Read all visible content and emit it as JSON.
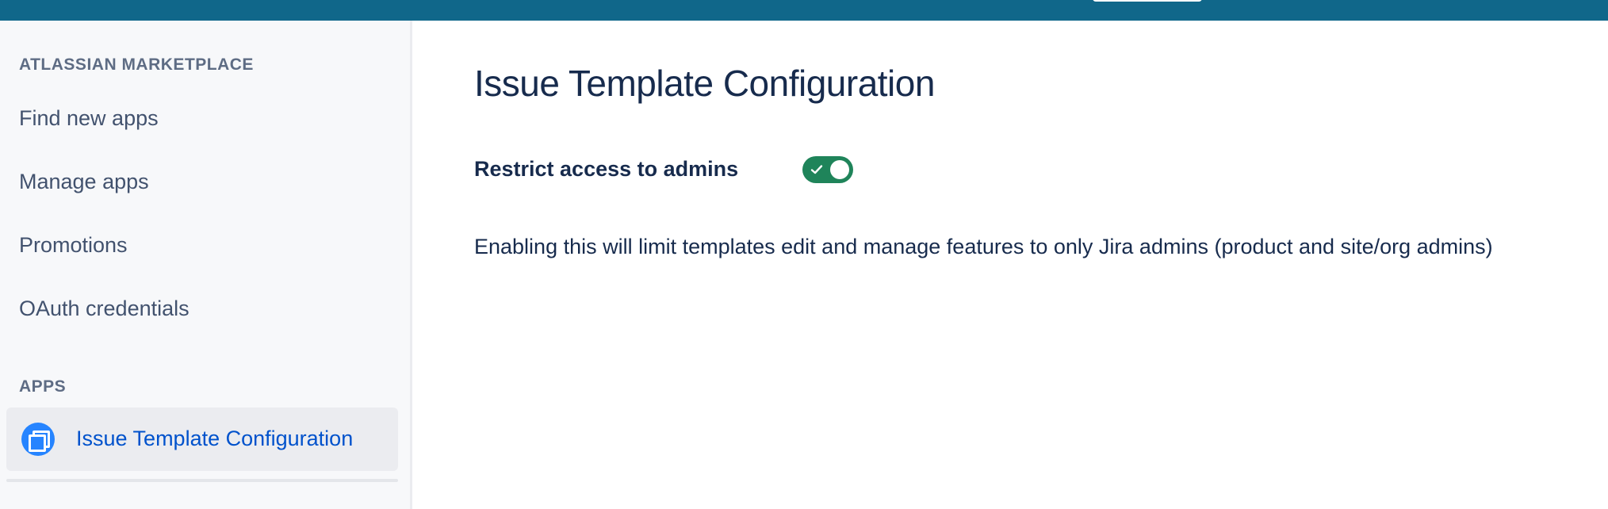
{
  "sidebar": {
    "marketplace_heading": "ATLASSIAN MARKETPLACE",
    "marketplace_items": [
      {
        "label": "Find new apps"
      },
      {
        "label": "Manage apps"
      },
      {
        "label": "Promotions"
      },
      {
        "label": "OAuth credentials"
      }
    ],
    "apps_heading": "APPS",
    "apps_items": [
      {
        "label": "Issue Template Configuration",
        "icon": "template-app-icon",
        "active": true
      }
    ]
  },
  "main": {
    "title": "Issue Template Configuration",
    "restrict_setting": {
      "label": "Restrict access to admins",
      "enabled": true,
      "description": "Enabling this will limit templates edit and manage features to only Jira admins (product and site/org admins)"
    }
  },
  "colors": {
    "topbar": "#10678a",
    "toggle_on": "#1f845a",
    "active_link": "#0052cc",
    "app_icon": "#2684ff"
  }
}
